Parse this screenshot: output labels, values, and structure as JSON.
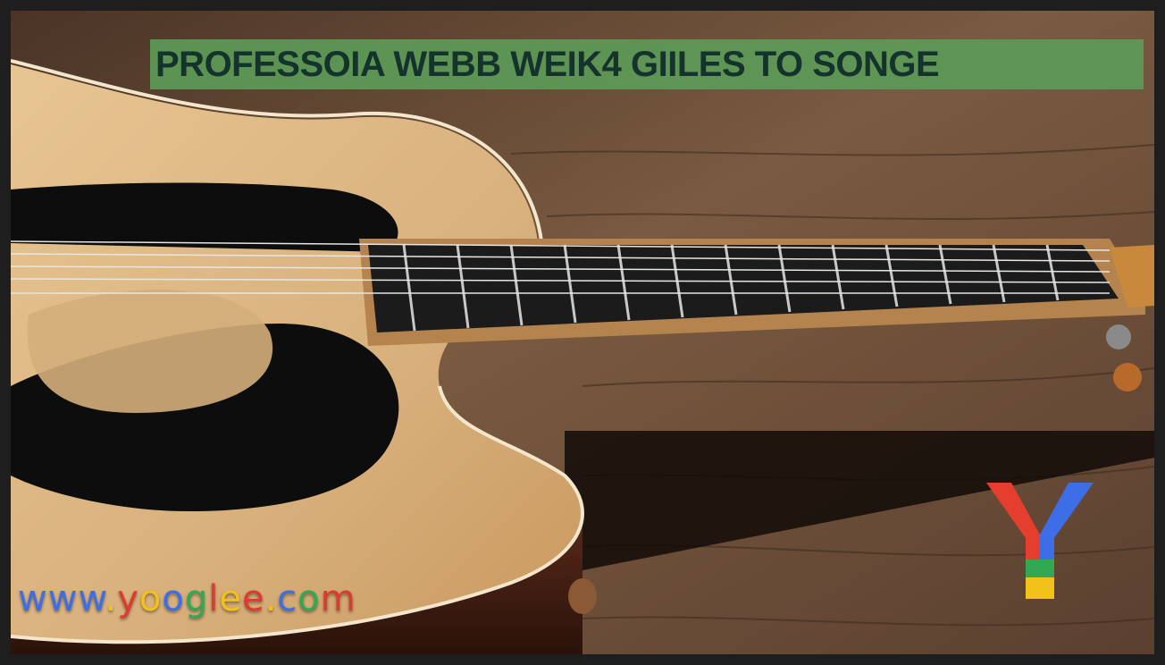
{
  "banner": {
    "title": "PROFESSOIA WEBB WEIK4 GIILES TO SONGE",
    "color": "#5d9a56"
  },
  "watermark": {
    "url": "www.yooglee.com",
    "letter_colors": [
      "#3d6ee8",
      "#3d6ee8",
      "#3d6ee8",
      "#f2c21b",
      "#e03a2e",
      "#f2c21b",
      "#3d6ee8",
      "#31a852",
      "#e03a2e",
      "#f2c21b",
      "#e03a2e",
      "#f2c21b",
      "#3d6ee8",
      "#31a852",
      "#e03a2e"
    ],
    "logo_icon": "y-logo-icon"
  },
  "photo": {
    "subject": "acoustic-guitar-on-wood",
    "wood_color": "#6b4a30",
    "guitar_top_color": "#dbb886"
  }
}
